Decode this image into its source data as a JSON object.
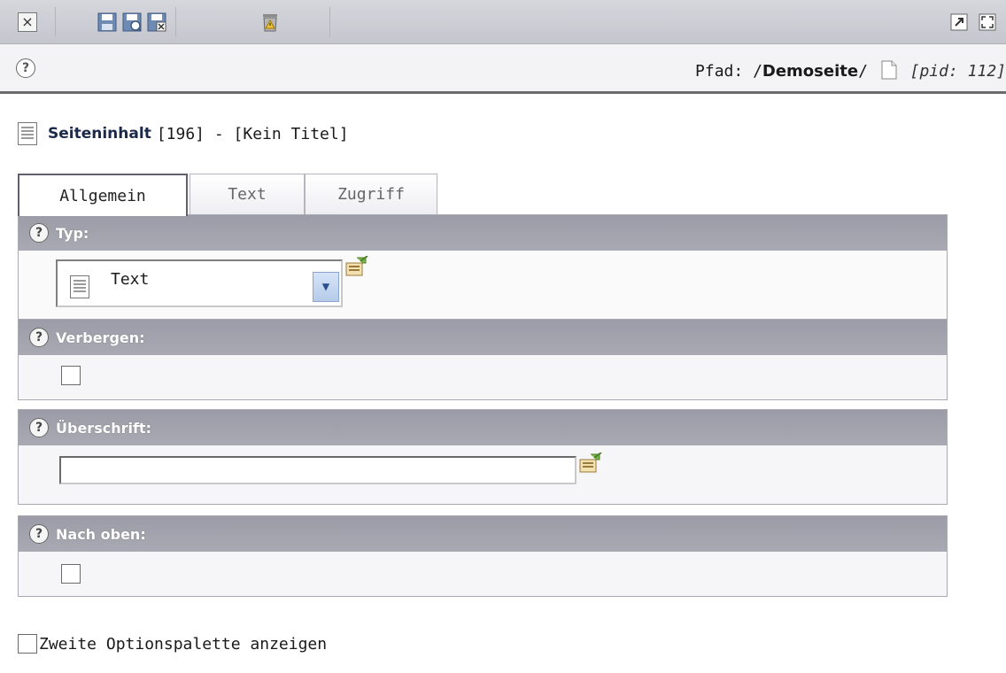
{
  "toolbar": {
    "icons": [
      "close-icon",
      "save-icon",
      "save-view-icon",
      "save-close-icon",
      "delete-icon",
      "open-new-window-icon",
      "fullscreen-icon"
    ]
  },
  "path": {
    "label": "Pfad: /",
    "segment": "Demoseite",
    "suffix": "/",
    "pid": "[pid: 112]"
  },
  "record": {
    "type_label": "Seiteninhalt",
    "rest": "[196] - [Kein Titel]"
  },
  "tabs": [
    {
      "label": "Allgemein",
      "active": true
    },
    {
      "label": "Text",
      "active": false
    },
    {
      "label": "Zugriff",
      "active": false
    }
  ],
  "fields": {
    "typ": {
      "label": "Typ:",
      "value": "Text"
    },
    "verbergen": {
      "label": "Verbergen:",
      "checked": false
    },
    "ueberschrift": {
      "label": "Überschrift:",
      "value": ""
    },
    "nach_oben": {
      "label": "Nach oben:",
      "checked": false
    }
  },
  "second_palette": {
    "label": "Zweite Optionspalette anzeigen",
    "checked": false
  },
  "colors": {
    "section_header": "#a3a3ae",
    "toolbar": "#cdcdd4",
    "title": "#1b2a4a"
  }
}
